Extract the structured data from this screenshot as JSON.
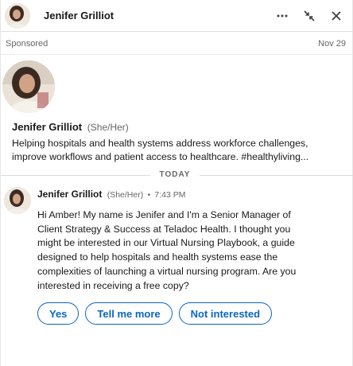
{
  "header": {
    "name": "Jenifer Grilliot",
    "icons": [
      "more-icon",
      "collapse-icon",
      "close-icon"
    ]
  },
  "sponsored": {
    "label": "Sponsored",
    "date": "Nov 29"
  },
  "profile": {
    "name": "Jenifer Grilliot",
    "pronouns": "(She/Her)",
    "headline": "Helping hospitals and health systems address workforce challenges, improve workflows and patient access to healthcare. #healthyliving..."
  },
  "divider": {
    "label": "TODAY"
  },
  "message": {
    "sender": "Jenifer Grilliot",
    "pronouns": "(She/Her)",
    "separator": "•",
    "time": "7:43 PM",
    "body": "Hi Amber! My name is Jenifer and I'm a Senior Manager of Client Strategy & Success at Teladoc Health. I thought you might be interested in our Virtual Nursing Playbook, a guide designed to help hospitals and health systems ease the complexities of launching a virtual nursing program. Are you interested in receiving a free copy?"
  },
  "replies": [
    {
      "label": "Yes"
    },
    {
      "label": "Tell me more"
    },
    {
      "label": "Not interested"
    }
  ],
  "colors": {
    "accent": "#0a66c2",
    "text": "#191919",
    "muted": "#666666",
    "divider": "#e0e0e0"
  }
}
